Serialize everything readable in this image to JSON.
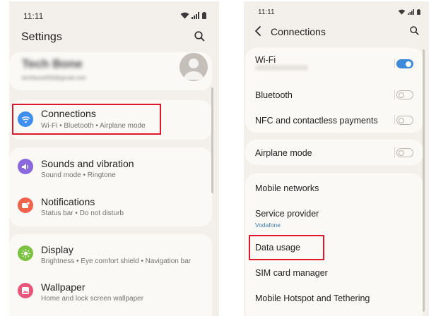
{
  "left": {
    "status_time": "11:11",
    "title": "Settings",
    "profile": {
      "name": "Tech Bone",
      "email": "techbone000@gmail.com"
    },
    "items": [
      {
        "title": "Connections",
        "subtitle": "Wi-Fi • Bluetooth • Airplane mode",
        "icon": "wifi-icon",
        "color": "#3d8ef0"
      },
      {
        "title": "Sounds and vibration",
        "subtitle": "Sound mode • Ringtone",
        "icon": "volume-icon",
        "color": "#8a68dd"
      },
      {
        "title": "Notifications",
        "subtitle": "Status bar • Do not disturb",
        "icon": "notification-icon",
        "color": "#f0624c"
      },
      {
        "title": "Display",
        "subtitle": "Brightness • Eye comfort shield • Navigation bar",
        "icon": "brightness-icon",
        "color": "#7cc241"
      },
      {
        "title": "Wallpaper",
        "subtitle": "Home and lock screen wallpaper",
        "icon": "wallpaper-icon",
        "color": "#e8567a"
      }
    ]
  },
  "right": {
    "status_time": "11:11",
    "title": "Connections",
    "items": [
      {
        "title": "Wi-Fi",
        "toggle": true
      },
      {
        "title": "Bluetooth",
        "toggle": false
      },
      {
        "title": "NFC and contactless payments",
        "toggle": false
      },
      {
        "title": "Airplane mode",
        "toggle": false
      },
      {
        "title": "Mobile networks"
      },
      {
        "title": "Service provider",
        "subtitle": "Vodafone"
      },
      {
        "title": "Data usage"
      },
      {
        "title": "SIM card manager"
      },
      {
        "title": "Mobile Hotspot and Tethering"
      }
    ]
  },
  "colors": {
    "highlight": "#e0162b",
    "toggle_on": "#3d8ad8",
    "background": "#f3efea",
    "card": "#fbf9f6"
  }
}
